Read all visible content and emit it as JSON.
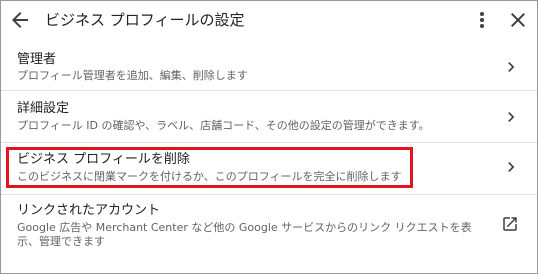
{
  "header": {
    "title": "ビジネス プロフィールの設定",
    "back_icon": "arrow-back-icon",
    "more_icon": "more-vert-icon",
    "close_icon": "close-icon"
  },
  "items": [
    {
      "title": "管理者",
      "description": "プロフィール管理者を追加、編集、削除します",
      "icon": "chevron-right-icon"
    },
    {
      "title": "詳細設定",
      "description": "プロフィール ID の確認や、ラベル、店舗コード、その他の設定の管理ができます。",
      "icon": "chevron-right-icon"
    },
    {
      "title": "ビジネス プロフィールを削除",
      "description": "このビジネスに閉業マークを付けるか、このプロフィールを完全に削除します",
      "icon": "chevron-right-icon"
    },
    {
      "title": "リンクされたアカウント",
      "description": "Google 広告や Merchant Center など他の Google サービスからのリンク リクエストを表示、管理できます",
      "icon": "open-in-new-icon"
    }
  ],
  "colors": {
    "highlight_border": "#e0141e",
    "text_primary": "#202124",
    "text_secondary": "#5f6368"
  }
}
